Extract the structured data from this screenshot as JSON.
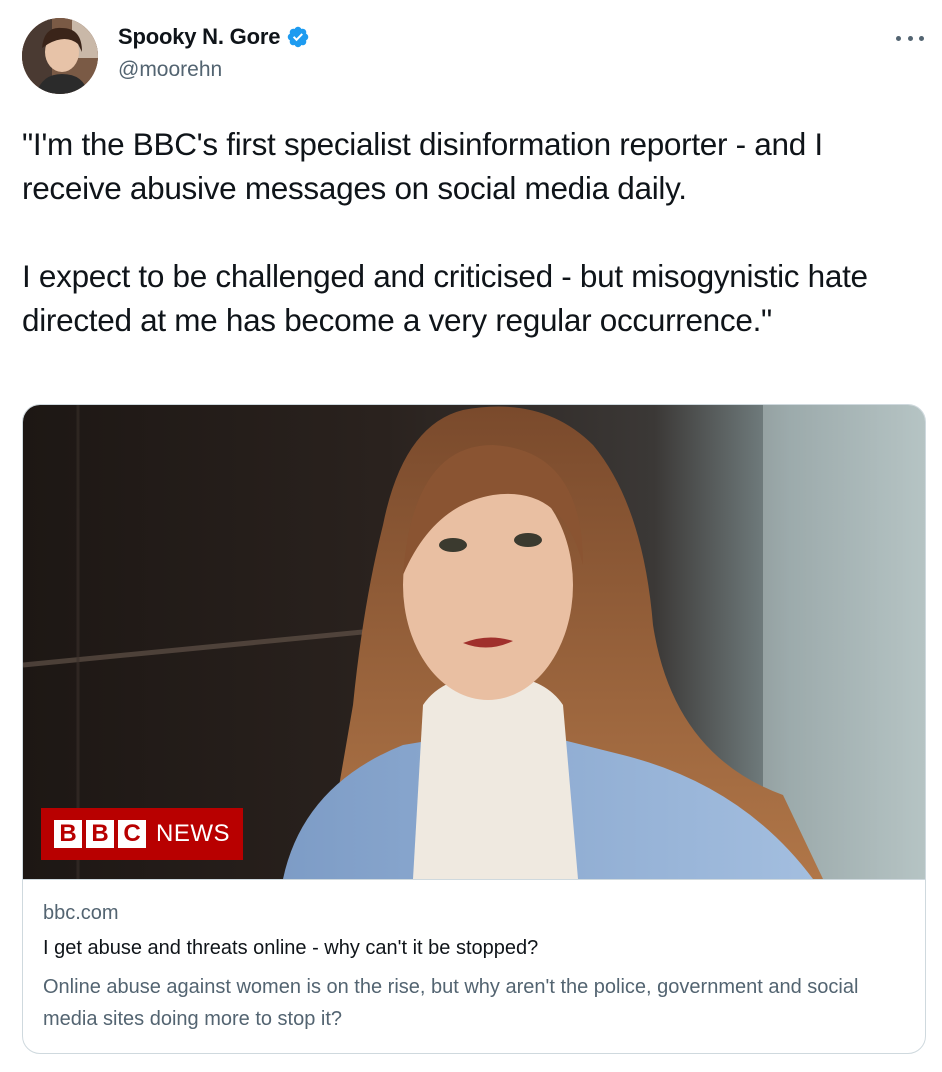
{
  "author": {
    "display_name": "Spooky N. Gore",
    "handle": "@moorehn",
    "verified": true,
    "verified_icon": "verified-badge-icon",
    "verified_color": "#1d9bf0"
  },
  "tweet": {
    "paragraphs": [
      "\"I'm the BBC's first specialist disinformation reporter - and I receive abusive messages on social media daily.",
      "I expect to be challenged and criticised - but misogynistic hate directed at me has become a very regular occurrence.\""
    ]
  },
  "card": {
    "badge": {
      "letters": [
        "B",
        "B",
        "C"
      ],
      "label": "NEWS",
      "color": "#b80000"
    },
    "domain": "bbc.com",
    "title": "I get abuse and threats online - why can't it be stopped?",
    "description": "Online abuse against women is on the rise, but why aren't the police, government and social media sites doing more to stop it?"
  },
  "colors": {
    "text_primary": "#0f1419",
    "text_secondary": "#536471",
    "border": "#cfd9de"
  }
}
